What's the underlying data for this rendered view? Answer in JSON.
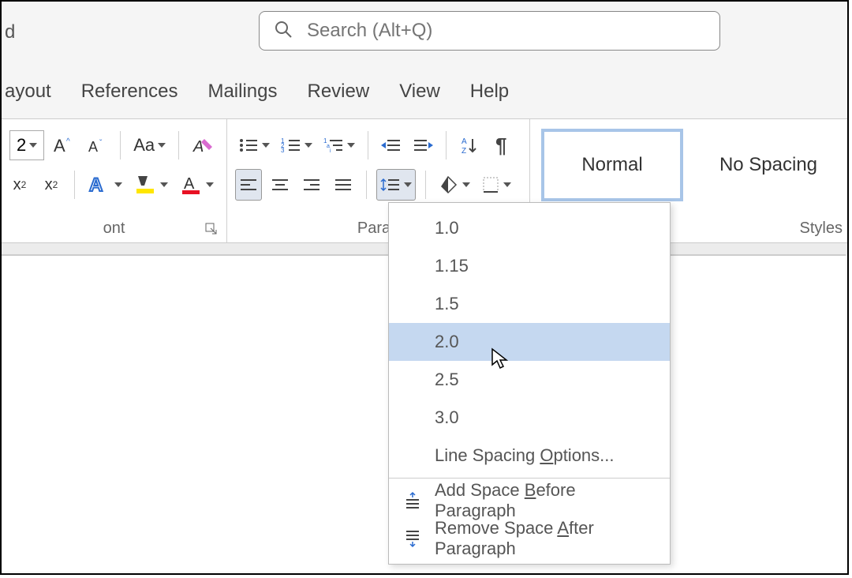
{
  "title_fragment": "d",
  "search": {
    "placeholder": "Search (Alt+Q)"
  },
  "tabs": [
    "ayout",
    "References",
    "Mailings",
    "Review",
    "View",
    "Help"
  ],
  "font_group": {
    "label": "ont",
    "size_fragment": "2"
  },
  "para_group": {
    "label": "Parag"
  },
  "styles_group": {
    "label": "Styles",
    "items": [
      "Normal",
      "No Spacing"
    ]
  },
  "line_spacing_menu": {
    "values": [
      "1.0",
      "1.15",
      "1.5",
      "2.0",
      "2.5",
      "3.0"
    ],
    "options_label": "Line Spacing Options...",
    "add_before": "Add Space Before Paragraph",
    "remove_after": "Remove Space After Paragraph",
    "highlighted": "2.0"
  }
}
